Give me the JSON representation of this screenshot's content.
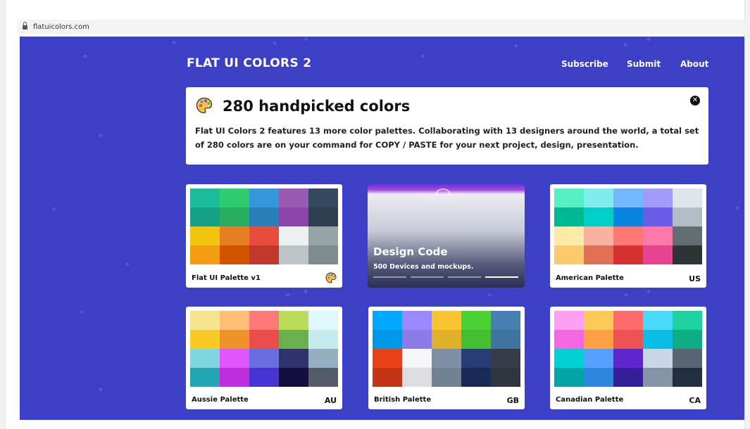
{
  "browser": {
    "url": "flatuicolors.com"
  },
  "header": {
    "brand": "FLAT UI COLORS 2",
    "nav": [
      {
        "label": "Subscribe"
      },
      {
        "label": "Submit"
      },
      {
        "label": "About"
      }
    ]
  },
  "banner": {
    "icon": "palette-icon",
    "title": "280 handpicked colors",
    "description": "Flat UI Colors 2 features 13 more color palettes. Collaborating with 13 designers around the world, a total set of 280 colors are on your command for COPY / PASTE for your next project, design, presentation.",
    "close_icon": "close-icon"
  },
  "ad": {
    "title": "Design Code",
    "subtitle": "500 Devices and mockups."
  },
  "palettes": [
    {
      "name": "Flat UI Palette v1",
      "flag": "",
      "icon": "palette-icon",
      "colors": [
        "#1abc9c",
        "#2ecc71",
        "#3498db",
        "#9b59b6",
        "#34495e",
        "#16a085",
        "#27ae60",
        "#2980b9",
        "#8e44ad",
        "#2c3e50",
        "#f1c40f",
        "#e67e22",
        "#e74c3c",
        "#ecf0f1",
        "#95a5a6",
        "#f39c12",
        "#d35400",
        "#c0392b",
        "#bdc3c7",
        "#7f8c8d"
      ]
    },
    {
      "name": "American Palette",
      "flag": "US",
      "colors": [
        "#55efc4",
        "#81ecec",
        "#74b9ff",
        "#a29bfe",
        "#dfe6e9",
        "#00b894",
        "#00cec9",
        "#0984e3",
        "#6c5ce7",
        "#b2bec3",
        "#ffeaa7",
        "#fab1a0",
        "#ff7675",
        "#fd79a8",
        "#636e72",
        "#fdcb6e",
        "#e17055",
        "#d63031",
        "#e84393",
        "#2d3436"
      ]
    },
    {
      "name": "Aussie Palette",
      "flag": "AU",
      "colors": [
        "#f6e58d",
        "#ffbe76",
        "#ff7979",
        "#badc58",
        "#dff9fb",
        "#f9ca24",
        "#f0932b",
        "#eb4d4b",
        "#6ab04c",
        "#c7ecee",
        "#7ed6df",
        "#e056fd",
        "#686de0",
        "#30336b",
        "#95afc0",
        "#22a6b3",
        "#be2edd",
        "#4834d4",
        "#130f40",
        "#535c68"
      ]
    },
    {
      "name": "British Palette",
      "flag": "GB",
      "colors": [
        "#00a8ff",
        "#9c88ff",
        "#fbc531",
        "#4cd137",
        "#487eb0",
        "#0097e6",
        "#8c7ae6",
        "#e1b12c",
        "#44bd32",
        "#40739e",
        "#e84118",
        "#f5f6fa",
        "#7f8fa6",
        "#273c75",
        "#353b48",
        "#c23616",
        "#dcdde1",
        "#718093",
        "#192a56",
        "#2f3640"
      ]
    },
    {
      "name": "Canadian Palette",
      "flag": "CA",
      "colors": [
        "#ff9ff3",
        "#feca57",
        "#ff6b6b",
        "#48dbfb",
        "#1dd1a1",
        "#f368e0",
        "#ff9f43",
        "#ee5253",
        "#0abde3",
        "#10ac84",
        "#00d2d3",
        "#54a0ff",
        "#5f27cd",
        "#c8d6e5",
        "#576574",
        "#01a3a4",
        "#2e86de",
        "#341f97",
        "#8395a7",
        "#222f3e"
      ]
    }
  ]
}
